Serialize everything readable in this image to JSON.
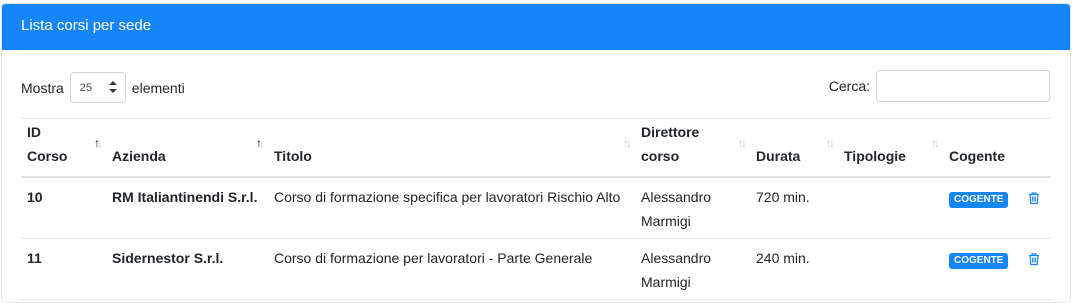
{
  "header": {
    "title": "Lista corsi per sede"
  },
  "length_menu": {
    "prefix": "Mostra",
    "value": "25",
    "suffix": "elementi"
  },
  "search": {
    "label": "Cerca:",
    "value": ""
  },
  "columns": [
    {
      "line1": "ID",
      "line2": "Corso"
    },
    {
      "line1": "",
      "line2": "Azienda"
    },
    {
      "line1": "",
      "line2": "Titolo"
    },
    {
      "line1": "Direttore",
      "line2": "corso"
    },
    {
      "line1": "",
      "line2": "Durata"
    },
    {
      "line1": "",
      "line2": "Tipologie"
    },
    {
      "line1": "",
      "line2": "Cogente"
    }
  ],
  "rows": [
    {
      "id": "10",
      "azienda": "RM Italiantinendi S.r.l.",
      "titolo": "Corso di formazione specifica per lavoratori Rischio Alto",
      "direttore": "Alessandro Marmigi",
      "durata": "720 min.",
      "tipologie": "",
      "cogente": "COGENTE"
    },
    {
      "id": "11",
      "azienda": "Sidernestor S.r.l.",
      "titolo": "Corso di formazione per lavoratori - Parte Generale",
      "direttore": "Alessandro Marmigi",
      "durata": "240 min.",
      "tipologie": "",
      "cogente": "COGENTE"
    }
  ],
  "colors": {
    "primary": "#1586f7"
  },
  "icons": {
    "delete": "trash-icon",
    "sort": "sort-icon"
  }
}
